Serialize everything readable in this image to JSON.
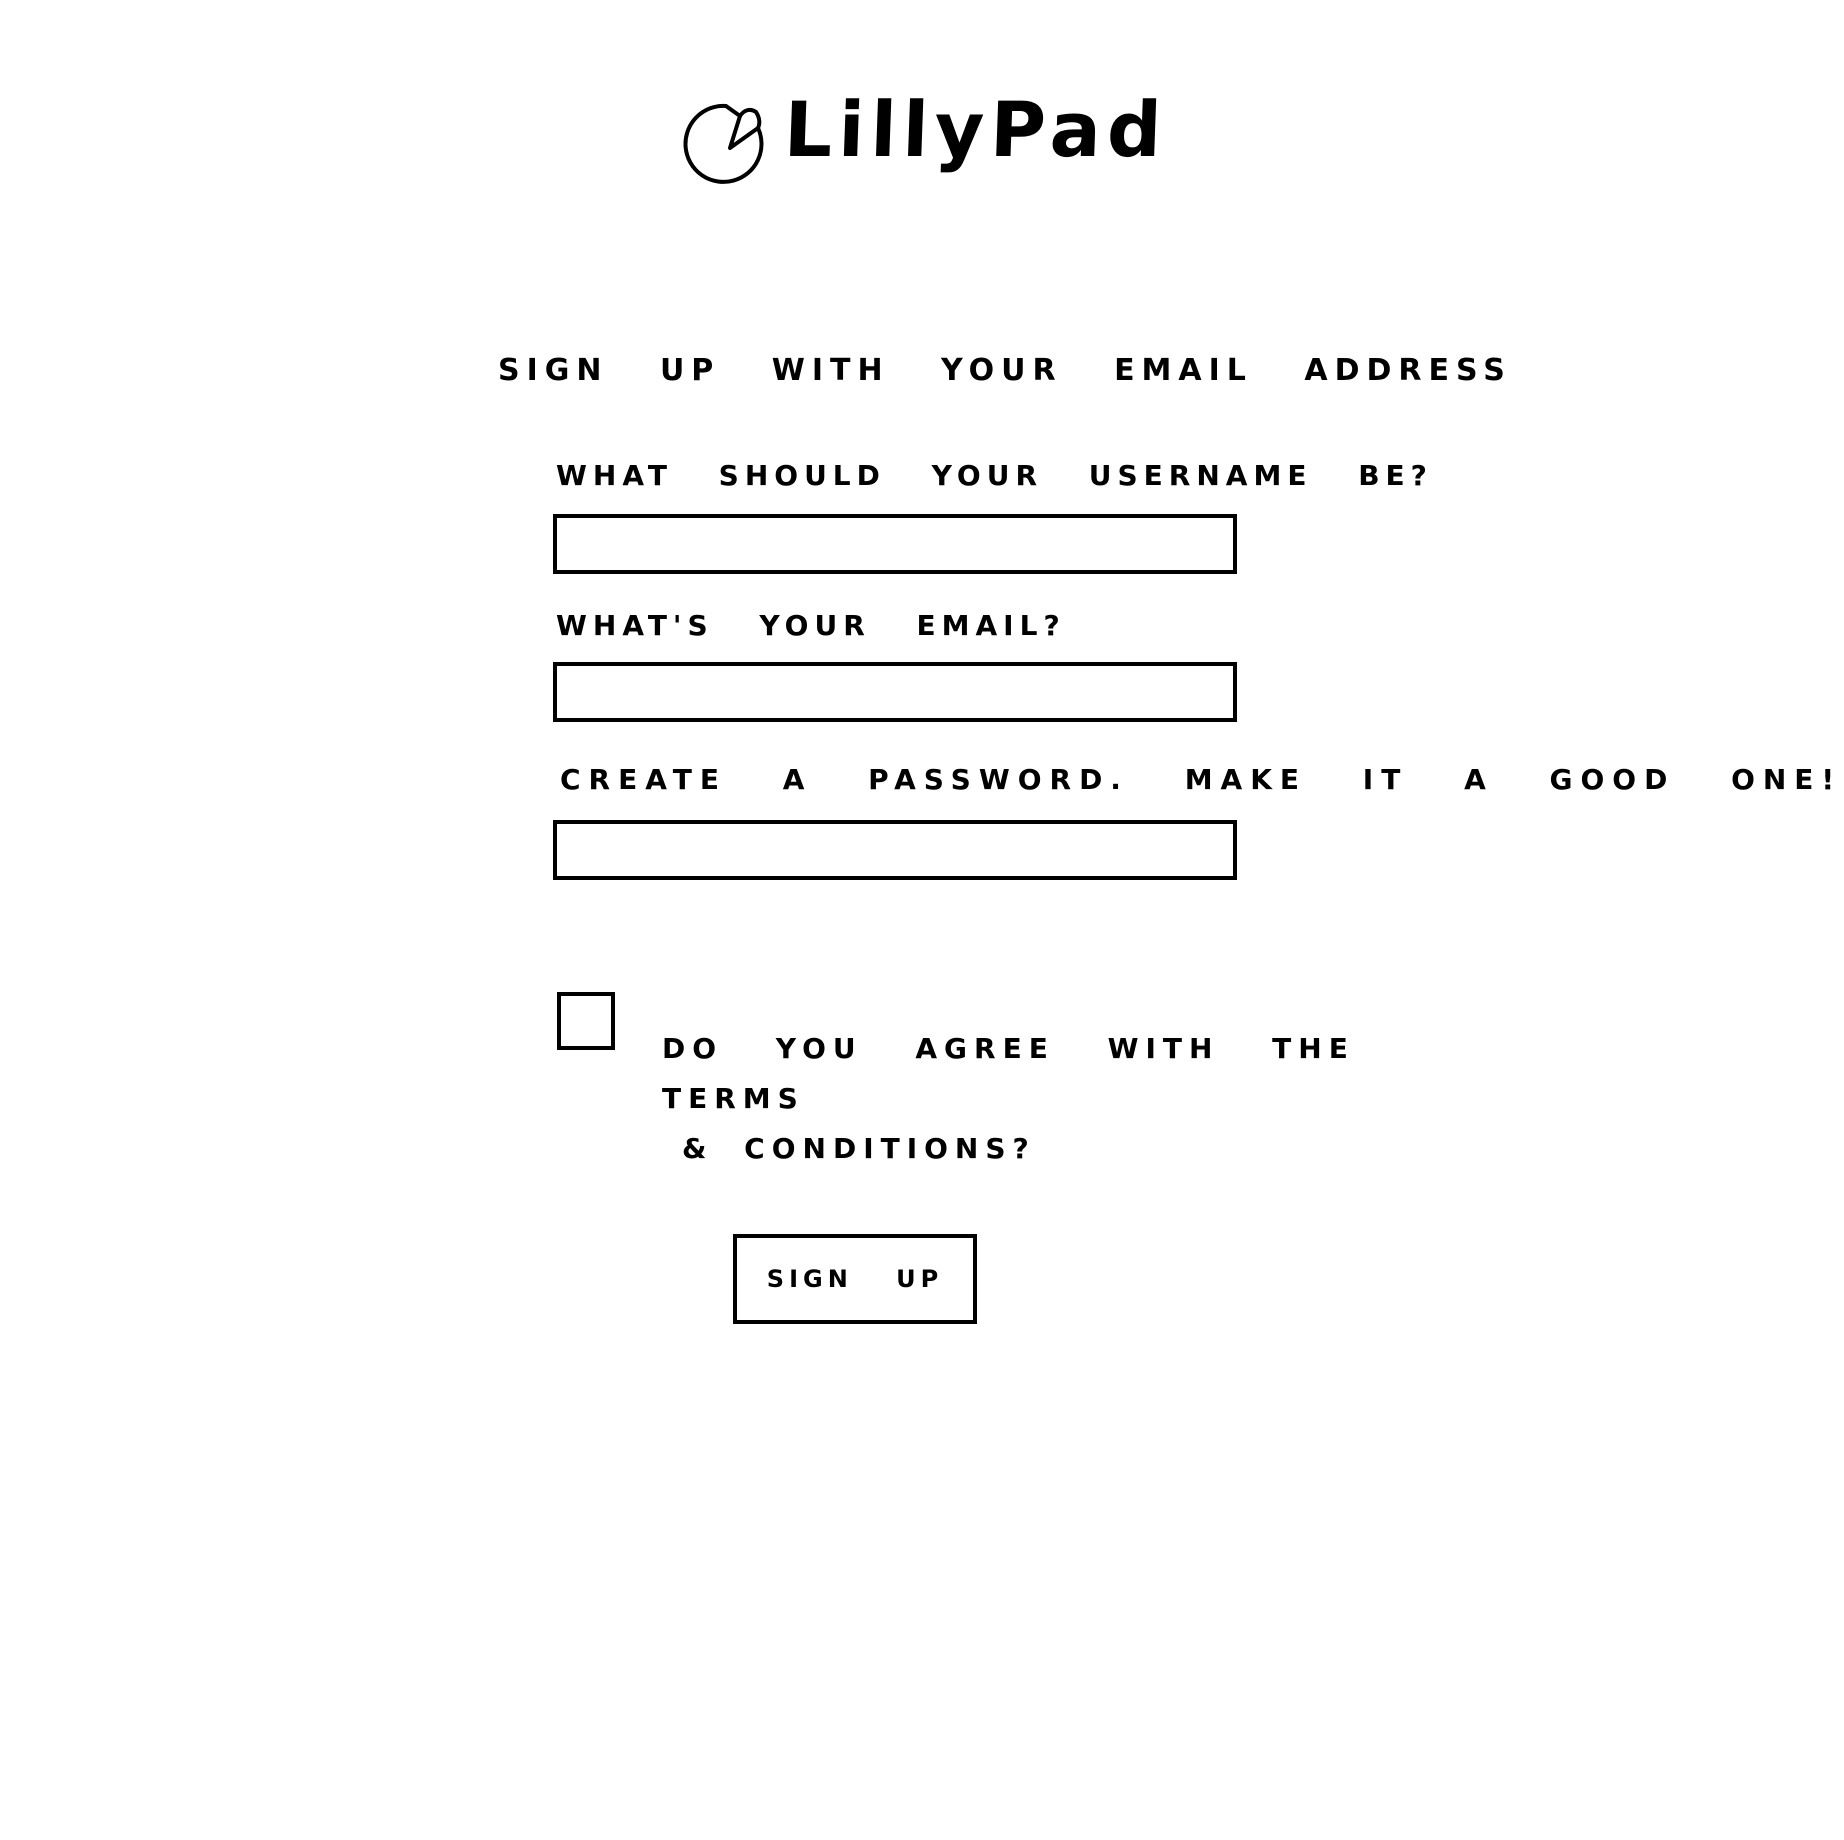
{
  "logo": {
    "text": "LillyPad",
    "icon": "lily-pad-icon"
  },
  "form": {
    "subtitle": "Sign up with your email address",
    "username_label": "What should your username be?",
    "username_value": "",
    "email_label": "What's your email?",
    "email_value": "",
    "password_label": "Create a password. Make it a good one!",
    "password_value": "",
    "terms_line1": "Do you agree with the terms",
    "terms_line2": "& conditions?",
    "terms_checked": false,
    "submit_label": "Sign up"
  },
  "colors": {
    "ink": "#000000",
    "background": "#ffffff"
  }
}
